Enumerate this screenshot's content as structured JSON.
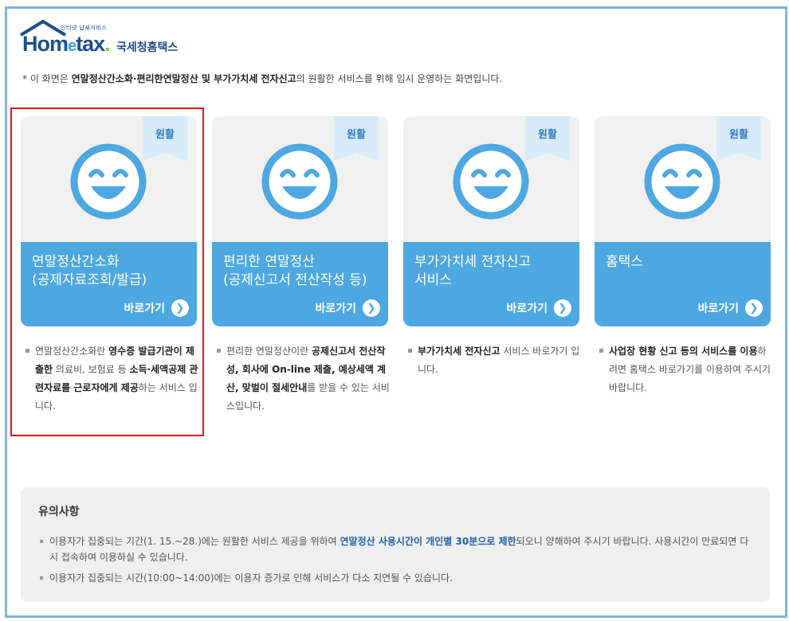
{
  "logo": {
    "sub": "인터넷 납세서비스",
    "word_pre": "Hom",
    "word_e": "e",
    "word_post": "tax",
    "word_dot": ".",
    "kr": "국세청홈택스"
  },
  "notice": {
    "prefix": "* 이 화면은 ",
    "bold": "연말정산간소화·편리한연말정산 및 부가가치세 전자신고",
    "suffix": "의 원활한 서비스를 위해 임시 운영하는 화면입니다."
  },
  "cards": [
    {
      "badge": "원활",
      "title_line1": "연말정산간소화",
      "title_line2": "(공제자료조회/발급)",
      "go": "바로가기",
      "desc_parts": [
        {
          "t": "연말정산간소화란 ",
          "b": false
        },
        {
          "t": "영수증 발급기관이 제출한",
          "b": true
        },
        {
          "t": " 의료비, 보험료 등 ",
          "b": false
        },
        {
          "t": "소득·세액공제 관련자료를 근로자에게 제공",
          "b": true
        },
        {
          "t": "하는 서비스 입니다.",
          "b": false
        }
      ]
    },
    {
      "badge": "원활",
      "title_line1": "편리한 연말정산",
      "title_line2": "(공제신고서 전산작성 등)",
      "go": "바로가기",
      "desc_parts": [
        {
          "t": "편리한 연말정산이란 ",
          "b": false
        },
        {
          "t": "공제신고서 전산작성, 회사에 On-line 제출, 예상세액 계산, 맞벌이 절세안내",
          "b": true
        },
        {
          "t": "를 받을 수 있는 서비스입니다.",
          "b": false
        }
      ]
    },
    {
      "badge": "원활",
      "title_line1": "부가가치세 전자신고",
      "title_line2": "서비스",
      "go": "바로가기",
      "desc_parts": [
        {
          "t": "부가가치세 전자신고",
          "b": true
        },
        {
          "t": " 서비스 바로가기 입니다.",
          "b": false
        }
      ]
    },
    {
      "badge": "원활",
      "title_line1": "홈택스",
      "title_line2": "",
      "go": "바로가기",
      "desc_parts": [
        {
          "t": "사업장 현황 신고 등의 서비스를 이용",
          "b": true
        },
        {
          "t": "하려면 홈택스 바로가기를 이용하여 주시기 바랍니다.",
          "b": false
        }
      ]
    }
  ],
  "caution": {
    "title": "유의사항",
    "item1_pre": "이용자가 집중되는 기간(1. 15.~28.)에는 원활한 서비스 제공을 위하여 ",
    "item1_bold": "연말정산 사용시간이 개인별 30분으로 제한",
    "item1_post": "되오니 양해하여 주시기 바랍니다. 사용시간이 만료되면 다시 접속하여 이용하실 수 있습니다.",
    "item2": "이용자가 집중되는 시간(10:00~14:00)에는 이용자 증가로 인해 서비스가 다소 지연될 수 있습니다."
  },
  "colors": {
    "accent": "#4da7e0",
    "badge_bg": "#d6ebf8",
    "highlight": "#e0161d"
  }
}
